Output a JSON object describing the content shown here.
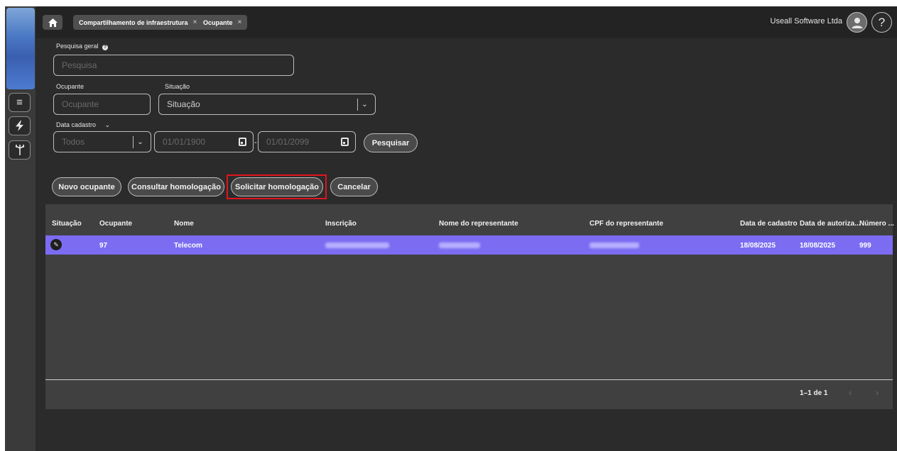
{
  "topbar": {
    "tabs": [
      {
        "label": "Compartilhamento de infraestrutura",
        "close": "×"
      },
      {
        "label": "Ocupante",
        "close": "×"
      }
    ],
    "company": "Useall Software Ltda",
    "help": "?"
  },
  "filters": {
    "general_search": {
      "label": "Pesquisa geral",
      "placeholder": "Pesquisa"
    },
    "occupant": {
      "label": "Ocupante",
      "placeholder": "Ocupante"
    },
    "status": {
      "label": "Situação",
      "value": "Situação"
    },
    "date_type": {
      "label": "Data cadastro"
    },
    "period": {
      "value": "Todos"
    },
    "date_from": "01/01/1900",
    "date_to": "01/01/2099",
    "date_separator": "-",
    "search_button": "Pesquisar"
  },
  "actions": {
    "new": "Novo ocupante",
    "consult": "Consultar homologação",
    "request": "Solicitar homologação",
    "cancel": "Cancelar"
  },
  "table": {
    "columns": [
      "Situação",
      "Ocupante",
      "Nome",
      "Inscrição",
      "Nome do representante",
      "CPF do representante",
      "Data de cadastro",
      "Data de autoriza...",
      "Número ..."
    ],
    "rows": [
      {
        "occupant": "97",
        "name": "Telecom",
        "registration_date": "18/08/2025",
        "authorization_date": "18/08/2025",
        "number": "999"
      }
    ],
    "pagination": "1–1 de 1"
  },
  "colors": {
    "selected_row": "#7b6cf2",
    "highlight_border": "#e0141e",
    "background": "#2b2b2b"
  }
}
